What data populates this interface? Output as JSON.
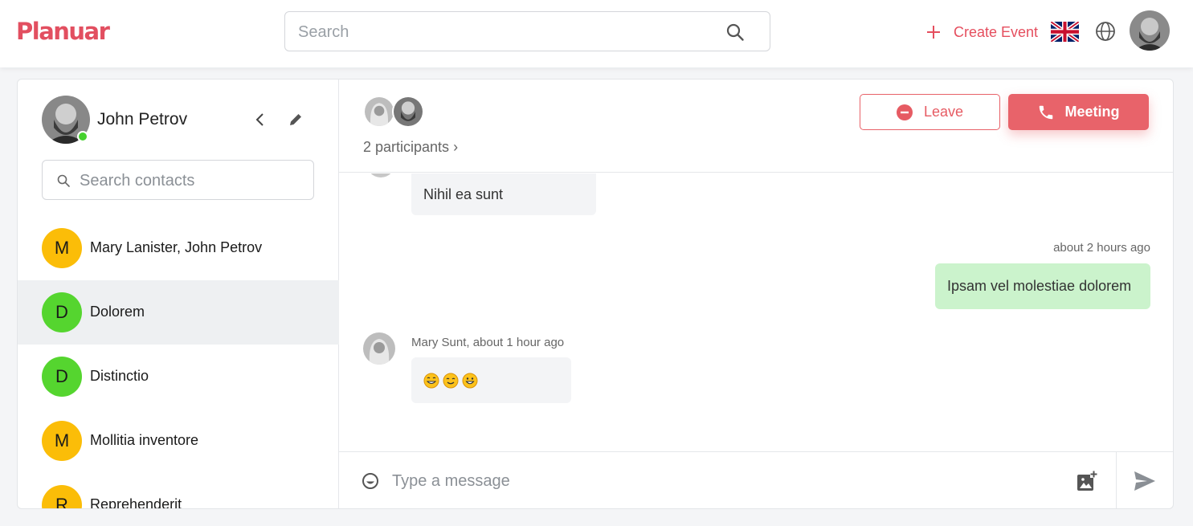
{
  "app": {
    "logo": "Planuar"
  },
  "header": {
    "search_placeholder": "Search",
    "create_event_label": "Create Event",
    "language_flag": "uk-flag-icon",
    "globe_icon": "globe-icon"
  },
  "sidebar": {
    "user_name": "John Petrov",
    "online": true,
    "search_placeholder": "Search contacts",
    "contacts": [
      {
        "name": "Mary Lanister, John Petrov",
        "initial": "M",
        "color": "#fbbd08",
        "active": false
      },
      {
        "name": "Dolorem",
        "initial": "D",
        "color": "#55d52f",
        "active": true
      },
      {
        "name": "Distinctio",
        "initial": "D",
        "color": "#55d52f",
        "active": false
      },
      {
        "name": "Mollitia inventore",
        "initial": "M",
        "color": "#fbbd08",
        "active": false
      },
      {
        "name": "Reprehenderit",
        "initial": "R",
        "color": "#fbbd08",
        "active": false
      }
    ]
  },
  "chat": {
    "participants_label": "2 participants",
    "leave_label": "Leave",
    "meeting_label": "Meeting",
    "messages": [
      {
        "text": "Nihil ea sunt",
        "direction": "incoming",
        "meta": ""
      },
      {
        "text": "Ipsam vel molestiae dolorem",
        "direction": "outgoing",
        "meta": "about 2 hours ago"
      },
      {
        "text": "😁😊😄",
        "direction": "incoming",
        "meta": "Mary Sunt, about 1 hour ago"
      }
    ],
    "composer_placeholder": "Type a message"
  },
  "colors": {
    "brand": "#e24f60",
    "meeting_button": "#e8636a",
    "outgoing_bubble": "#cbf3cc",
    "incoming_bubble": "#f3f4f6",
    "online": "#45d12e"
  }
}
